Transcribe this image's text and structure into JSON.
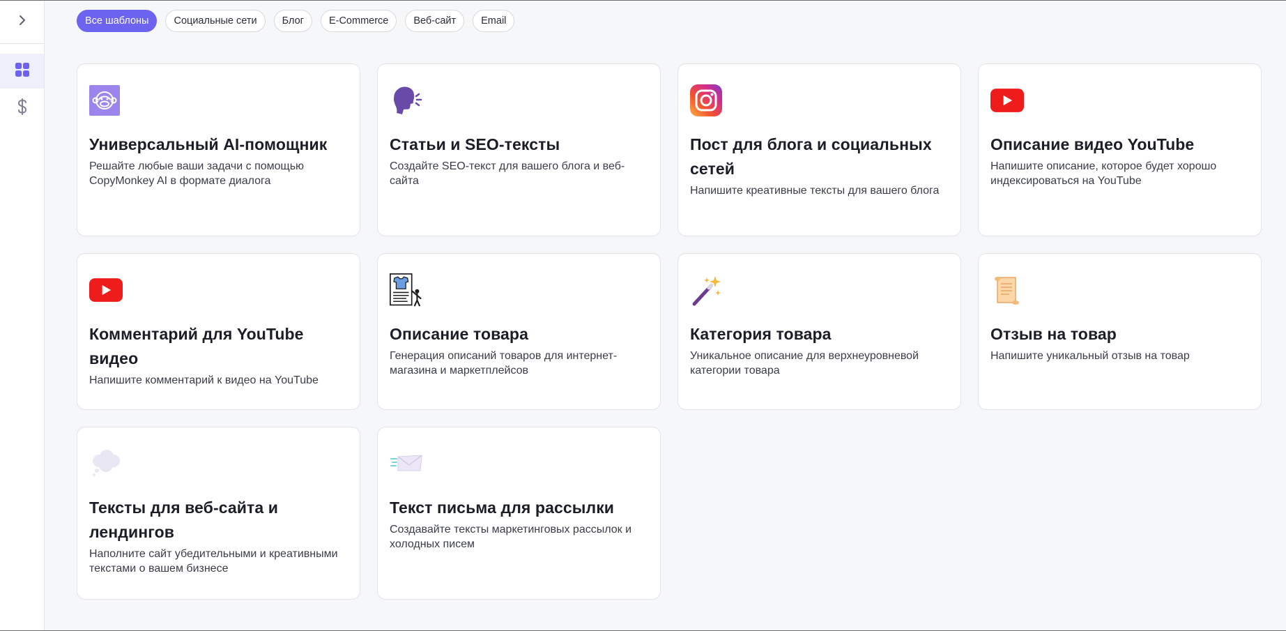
{
  "sidebar": {
    "toggle_icon": "chevron-right-icon",
    "items": [
      {
        "name": "templates",
        "icon": "grid-icon",
        "active": true
      },
      {
        "name": "billing",
        "icon": "dollar-icon",
        "active": false
      }
    ]
  },
  "filters": [
    {
      "label": "Все шаблоны",
      "active": true
    },
    {
      "label": "Социальные сети",
      "active": false
    },
    {
      "label": "Блог",
      "active": false
    },
    {
      "label": "E-Commerce",
      "active": false
    },
    {
      "label": "Веб-сайт",
      "active": false
    },
    {
      "label": "Email",
      "active": false
    }
  ],
  "cards": [
    {
      "icon": "monkey-icon",
      "title": "Универсальный AI-помощник",
      "desc": "Решайте любые ваши задачи с помощью CopyMonkey AI в формате диалога"
    },
    {
      "icon": "speaking-head-icon",
      "title": "Статьи и SEO-тексты",
      "desc": "Создайте SEO-текст для вашего блога и веб-сайта"
    },
    {
      "icon": "instagram-icon",
      "title": "Пост для блога и социальных сетей",
      "desc": "Напишите креативные тексты для вашего блога"
    },
    {
      "icon": "youtube-icon",
      "title": "Описание видео YouTube",
      "desc": "Напишите описание, которое будет хорошо индексироваться на YouTube"
    },
    {
      "icon": "youtube-icon",
      "title": "Комментарий для YouTube видео",
      "desc": "Напишите комментарий к видео на YouTube"
    },
    {
      "icon": "product-presentation-icon",
      "title": "Описание товара",
      "desc": "Генерация описаний товаров для интернет-магазина и маркетплейсов"
    },
    {
      "icon": "magic-wand-icon",
      "title": "Категория товара",
      "desc": "Уникальное описание для верхнеуровневой категории товара"
    },
    {
      "icon": "scroll-icon",
      "title": "Отзыв на товар",
      "desc": "Напишите уникальный отзыв на товар"
    },
    {
      "icon": "thought-bubble-icon",
      "title": "Тексты для веб-сайта и лендингов",
      "desc": "Наполните сайт убедительными и креативными текстами о вашем бизнесе"
    },
    {
      "icon": "envelope-icon",
      "title": "Текст письма для рассылки",
      "desc": "Создавайте тексты маркетинговых рассылок и холодных писем"
    }
  ],
  "colors": {
    "accent": "#6c63f0",
    "background": "#f6f7f9",
    "card_border": "#e2e4e9"
  }
}
